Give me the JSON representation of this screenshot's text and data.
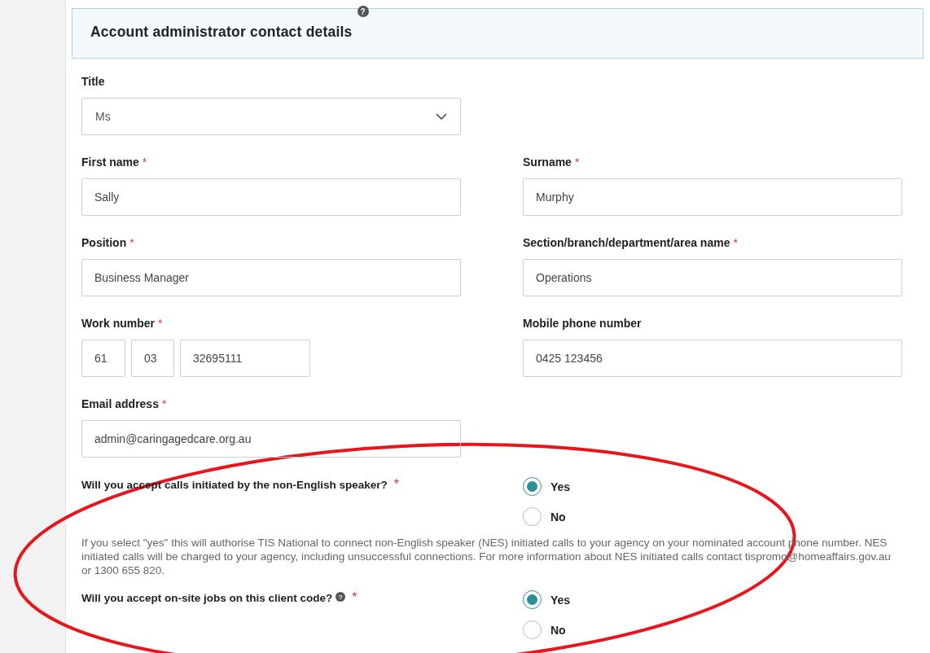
{
  "panel": {
    "title": "Account administrator contact details",
    "help_icon": "?"
  },
  "field_rows": [
    [
      {
        "kind": "select",
        "label": "Title",
        "value": "Ms"
      }
    ],
    [
      {
        "kind": "text",
        "label": "First name",
        "required_mark": "*",
        "value": "Sally"
      },
      {
        "kind": "text",
        "label": "Surname",
        "required_mark": "*",
        "value": "Murphy"
      }
    ],
    [
      {
        "kind": "text",
        "label": "Position",
        "required_mark": "*",
        "value": "Business Manager"
      },
      {
        "kind": "text",
        "label": "Section/branch/department/area name",
        "required_mark": "*",
        "value": "Operations"
      }
    ],
    [
      {
        "kind": "phone",
        "label": "Work number",
        "required_mark": "*",
        "parts": [
          "61",
          "03",
          "32695111"
        ]
      },
      {
        "kind": "text",
        "label": "Mobile phone number",
        "value": "0425 123456"
      }
    ],
    [
      {
        "kind": "text",
        "label": "Email address",
        "required_mark": "*",
        "value": "admin@caringagedcare.org.au"
      }
    ]
  ],
  "questions": [
    {
      "label": "Will you accept calls initiated by the non-English speaker?",
      "required_mark": "*",
      "options": [
        {
          "label": "Yes",
          "selected": true
        },
        {
          "label": "No",
          "selected": false
        }
      ],
      "note": "If you select \"yes\" this will authorise TIS National to connect non-English speaker (NES) initiated calls to your agency on your nominated account phone number. NES initiated calls will be charged to your agency, including unsuccessful connections. For more information about NES initiated calls contact tispromo@homeaffairs.gov.au or 1300 655 820."
    },
    {
      "label": "Will you accept on-site jobs on this client code?",
      "help_icon": "?",
      "required_mark": "*",
      "options": [
        {
          "label": "Yes",
          "selected": true
        },
        {
          "label": "No",
          "selected": false
        }
      ]
    }
  ],
  "annotation": {
    "kind": "ellipse"
  }
}
